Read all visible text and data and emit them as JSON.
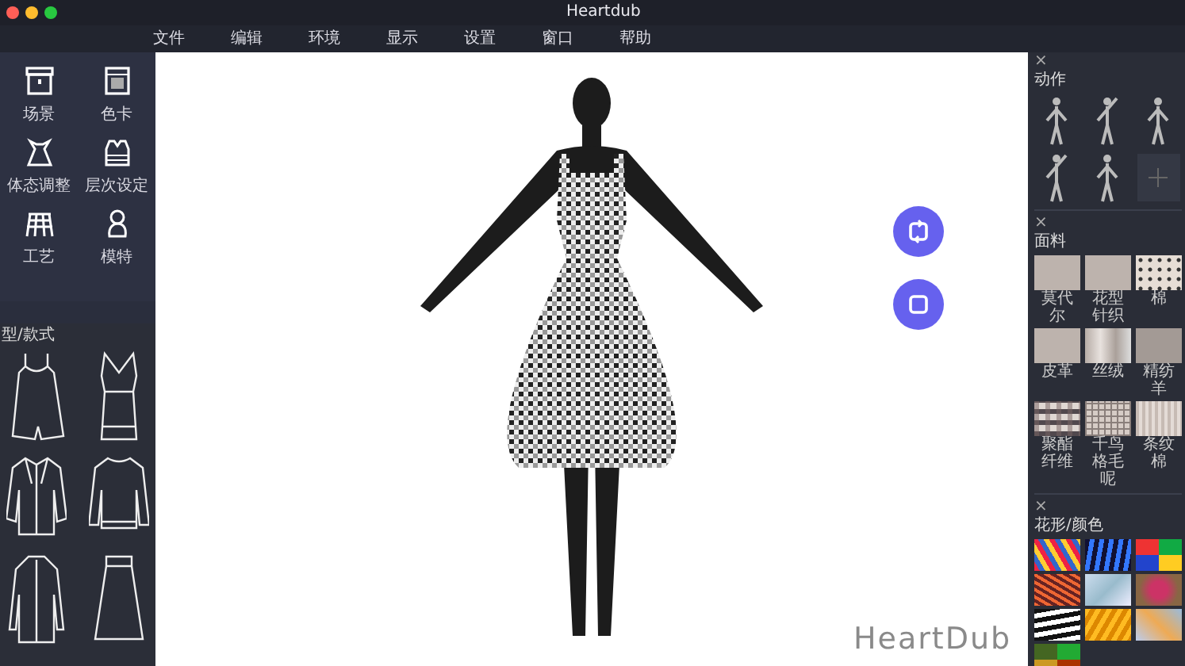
{
  "window": {
    "title": "Heartdub"
  },
  "menu": [
    "文件",
    "编辑",
    "环境",
    "显示",
    "设置",
    "窗口",
    "帮助"
  ],
  "tools": [
    {
      "label": "场景",
      "kind": "scene"
    },
    {
      "label": "色卡",
      "kind": "swatch"
    },
    {
      "label": "体态调整",
      "kind": "dress"
    },
    {
      "label": "层次设定",
      "kind": "vest"
    },
    {
      "label": "工艺",
      "kind": "craft"
    },
    {
      "label": "模特",
      "kind": "model"
    }
  ],
  "styles_panel": {
    "title": "型/款式"
  },
  "viewport": {
    "logo": "HeartDub"
  },
  "poses_panel": {
    "close": "×",
    "title": "动作"
  },
  "fabric_panel": {
    "close": "×",
    "title": "面料",
    "fabrics": [
      {
        "label": "莫代尔",
        "kind": "plain"
      },
      {
        "label": "花型针织",
        "kind": "plain"
      },
      {
        "label": "棉",
        "kind": "dots"
      },
      {
        "label": "皮革",
        "kind": "plain"
      },
      {
        "label": "丝绒",
        "kind": "velvet"
      },
      {
        "label": "精纺羊",
        "kind": "dark"
      },
      {
        "label": "聚酯纤维",
        "kind": "plaid"
      },
      {
        "label": "千鸟格毛呢",
        "kind": "check"
      },
      {
        "label": "条纹棉",
        "kind": "stripe"
      }
    ]
  },
  "pattern_panel": {
    "close": "×",
    "title": "花形/颜色"
  }
}
